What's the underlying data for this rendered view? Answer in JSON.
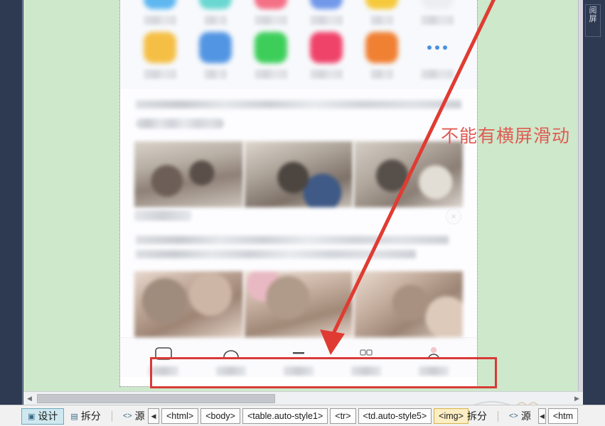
{
  "window": {
    "right_vertical_tab": [
      "阅",
      "屏"
    ]
  },
  "annotation": {
    "note_text": "不能有横屏滑动",
    "note_color": "#e05a52",
    "rect_color": "#d83a36",
    "arrow_color": "#e03b32"
  },
  "canvas": {
    "background_color": "#cde8ca",
    "page_background": "#ffffff"
  },
  "phone_page": {
    "icon_grid": {
      "row1": [
        {
          "name": "app-icon-1",
          "color": "#57b4f0"
        },
        {
          "name": "app-icon-2",
          "color": "#63d6cf"
        },
        {
          "name": "app-icon-3",
          "color": "#f4697f"
        },
        {
          "name": "app-icon-4",
          "color": "#6b94e8"
        },
        {
          "name": "app-icon-5",
          "color": "#f6c733"
        },
        {
          "name": "app-icon-6",
          "color": "#e8eaee"
        }
      ],
      "row2": [
        {
          "name": "app-icon-7",
          "color": "#f5bc3c"
        },
        {
          "name": "app-icon-8",
          "color": "#4a90e2"
        },
        {
          "name": "app-icon-9",
          "color": "#34cc52"
        },
        {
          "name": "app-icon-10",
          "color": "#ef3a62"
        },
        {
          "name": "app-icon-11",
          "color": "#f07a28"
        },
        {
          "name": "app-icon-more",
          "color": "#4a90e2"
        }
      ]
    },
    "close_button_glyph": "×",
    "bottom_nav": [
      {
        "name": "nav-item-1",
        "icon": "chat-bubble-icon"
      },
      {
        "name": "nav-item-2",
        "icon": "compass-icon"
      },
      {
        "name": "nav-item-3",
        "icon": "list-icon"
      },
      {
        "name": "nav-item-4",
        "icon": "grid-icon"
      },
      {
        "name": "nav-item-5",
        "icon": "person-icon"
      }
    ]
  },
  "scrollbar": {
    "left_arrow": "◀",
    "right_arrow": "▶"
  },
  "statusbar": {
    "views": [
      {
        "name": "design-view-button",
        "label": "设计",
        "icon": "design-icon",
        "active": true
      },
      {
        "name": "split-view-button",
        "label": "拆分",
        "icon": "split-icon",
        "active": false
      },
      {
        "name": "source-view-button",
        "label": "源",
        "icon": "code-icon",
        "active": false
      }
    ],
    "views_right": [
      {
        "name": "split-view-button-2",
        "label": "拆分",
        "icon": "split-icon",
        "active": false
      },
      {
        "name": "source-view-button-2",
        "label": "源",
        "icon": "code-icon",
        "active": false
      }
    ],
    "breadcrumb_nav_left": "◀",
    "breadcrumb_nav_right": "▶",
    "breadcrumb": [
      {
        "name": "tag-html",
        "label": "<html>",
        "selected": false
      },
      {
        "name": "tag-body",
        "label": "<body>",
        "selected": false
      },
      {
        "name": "tag-table",
        "label": "<table.auto-style1>",
        "selected": false
      },
      {
        "name": "tag-tr",
        "label": "<tr>",
        "selected": false
      },
      {
        "name": "tag-td",
        "label": "<td.auto-style5>",
        "selected": false
      },
      {
        "name": "tag-img",
        "label": "<img>",
        "selected": true
      }
    ],
    "breadcrumb_right": [
      {
        "name": "tag-html-2",
        "label": "<htm",
        "selected": false
      }
    ]
  }
}
